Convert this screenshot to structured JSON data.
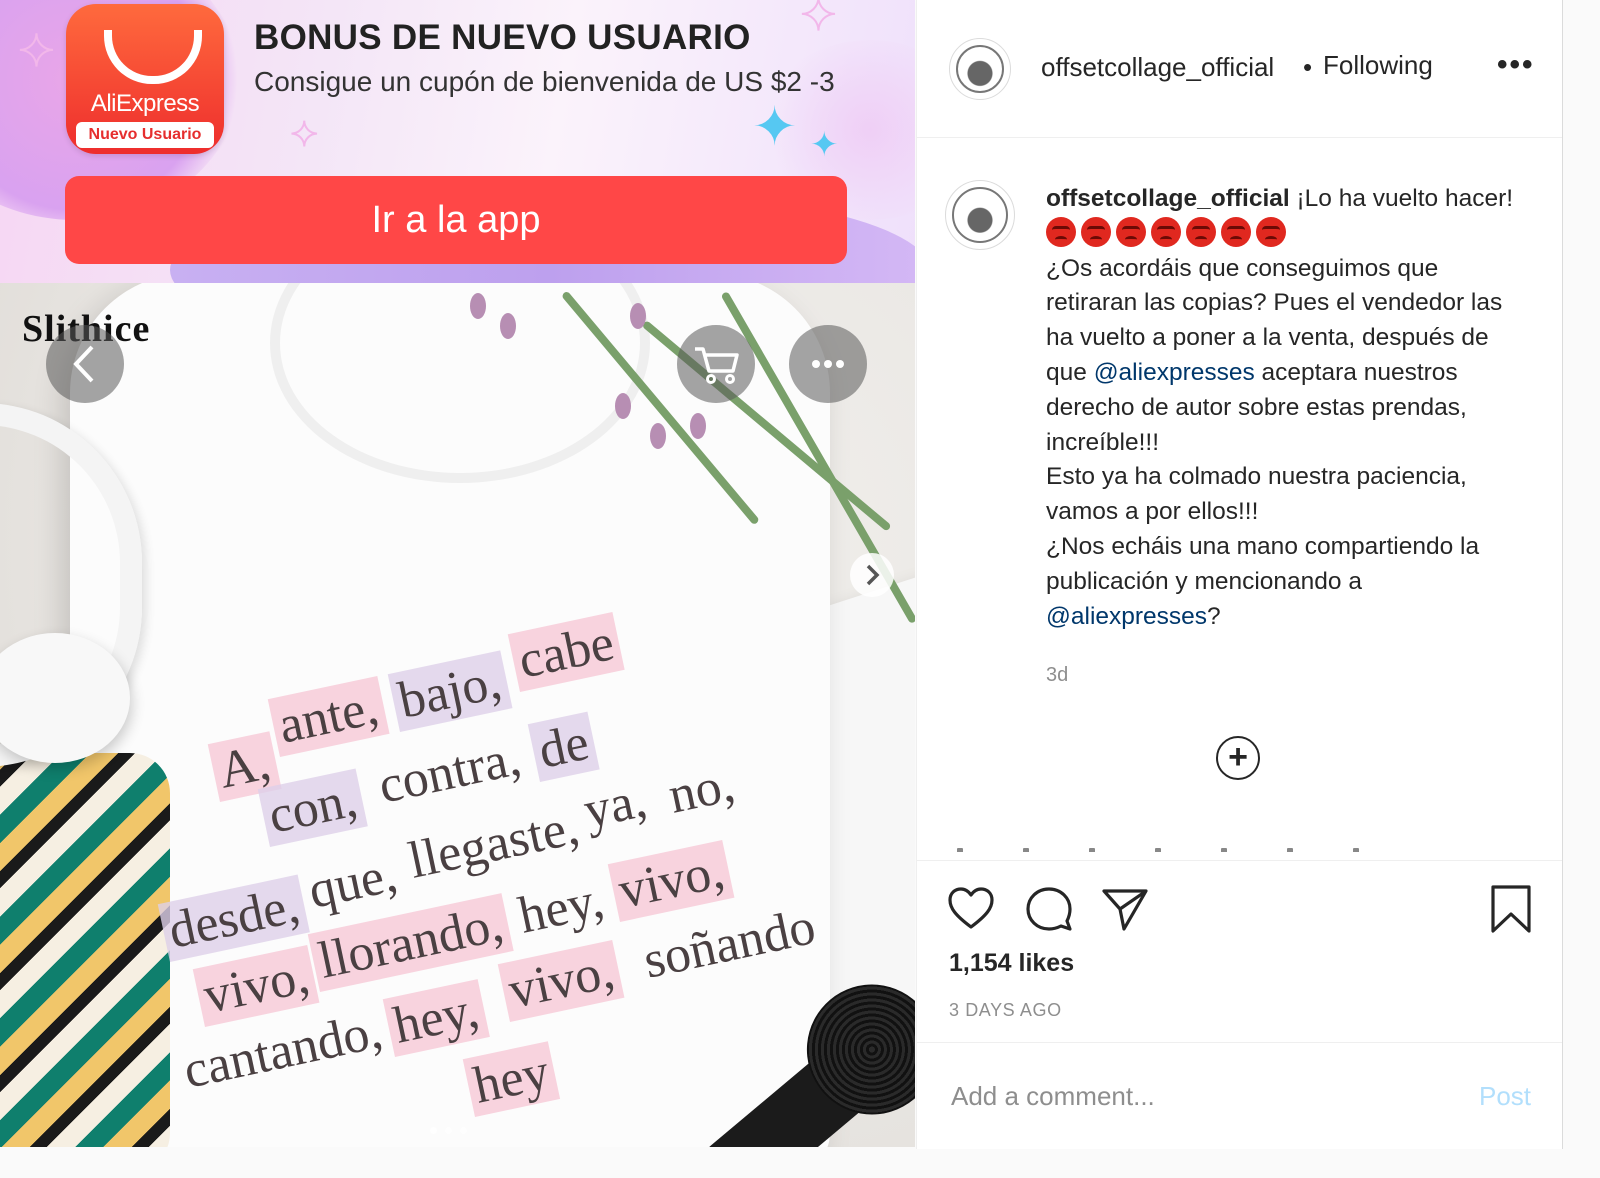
{
  "ad_banner": {
    "logo_brand": "AliExpress",
    "logo_subtitle": "Nuevo Usuario",
    "title": "BONUS DE NUEVO USUARIO",
    "text": "Consigue un cupón de bienvenida de US $2 -3",
    "button_label": "Ir a la app",
    "button_color": "#ff4747"
  },
  "media": {
    "watermark": "Slithice",
    "prev_icon": "chevron-left-icon",
    "next_icon": "chevron-right-icon",
    "cart_icon": "cart-icon",
    "more_icon": "more-dots-icon",
    "shirt_words": [
      "A,",
      "ante,",
      "bajo,",
      "cabe",
      "con,",
      "contra,",
      "de",
      "desde,",
      "que,",
      "llegaste,",
      "ya,",
      "no,",
      "vivo,",
      "llorando,",
      "hey,",
      "vivo,",
      "cantando,",
      "hey,",
      "vivo,",
      "soñando",
      "hey"
    ]
  },
  "post_header": {
    "username": "offsetcollage_official",
    "separator": "•",
    "follow_status": "Following",
    "more_label": "•••"
  },
  "caption": {
    "username": "offsetcollage_official",
    "line1": " ¡Lo ha vuelto hacer!",
    "emoji_count": 7,
    "emoji_icon": "angry-face-icon",
    "body_a": "¿Os acordáis que conseguimos que retiraran las copias? Pues el vendedor las ha vuelto a poner a la venta, después de que ",
    "mention1": "@aliexpresses",
    "body_b": " aceptara nuestros derecho de autor sobre estas prendas, increíble!!!",
    "body_c": "Esto ya ha colmado nuestra paciencia, vamos a por ellos!!!",
    "body_d": "¿Nos echáis una mano compartiendo la publicación y mencionando a ",
    "mention2": "@aliexpresses",
    "body_e": "?",
    "time": "3d"
  },
  "load_more_icon": "plus-circle-icon",
  "actions": {
    "icons": [
      "heart-icon",
      "comment-icon",
      "share-icon",
      "bookmark-icon"
    ],
    "likes": "1,154 likes",
    "date": "3 DAYS AGO"
  },
  "comment_box": {
    "placeholder": "Add a comment...",
    "post_label": "Post",
    "post_color": "#b2dffc"
  },
  "colors": {
    "mention": "#00376b",
    "secondary_text": "#8e8e8e",
    "border": "#efefef"
  }
}
